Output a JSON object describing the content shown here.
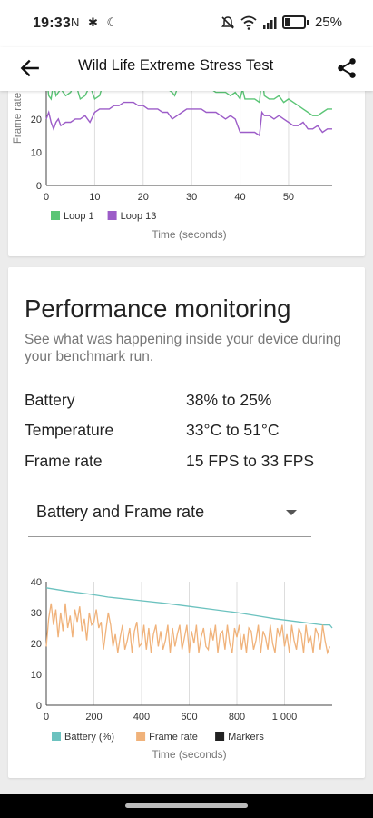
{
  "status_bar": {
    "time": "19:33",
    "left_icons": "N ✱ ☾",
    "battery_text": "25%"
  },
  "app_bar": {
    "title": "Wild Life Extreme Stress Test"
  },
  "chart_data": [
    {
      "type": "line",
      "title": "",
      "xlabel": "Time (seconds)",
      "ylabel": "Frame rate",
      "xlim": [
        0,
        59
      ],
      "ylim": [
        0,
        35
      ],
      "x_ticks": [
        "0",
        "10",
        "20",
        "30",
        "40",
        "50"
      ],
      "y_ticks": [
        "0",
        "10",
        "20"
      ],
      "legend_position": "bottom",
      "series": [
        {
          "name": "Loop 1",
          "color": "#5bc576",
          "x": [
            0,
            0.5,
            1,
            1.5,
            2,
            2.5,
            3,
            4,
            5,
            6,
            7,
            8,
            9,
            10,
            11,
            12,
            12.5,
            13,
            14,
            15,
            16,
            17,
            18,
            19,
            20,
            21,
            22,
            23,
            24,
            25,
            26,
            26.5,
            27,
            28,
            29,
            30,
            31,
            32,
            33,
            34,
            35,
            36,
            37,
            38,
            39,
            40,
            40.5,
            41,
            42,
            43,
            44,
            44.5,
            45,
            46,
            47,
            48,
            49,
            50,
            51,
            52,
            53,
            54,
            55,
            56,
            57,
            58,
            59
          ],
          "y": [
            33,
            27,
            26,
            31,
            27,
            28,
            29,
            27,
            28,
            31,
            26,
            27,
            30,
            26,
            27,
            32,
            29,
            31,
            30,
            31,
            31,
            30,
            31,
            31,
            31,
            30,
            31,
            31,
            30,
            29,
            28,
            27,
            29,
            30,
            30,
            29,
            30,
            29,
            29,
            29,
            28,
            28,
            28,
            27,
            28,
            26,
            29,
            26,
            26,
            26,
            25,
            33,
            27,
            26,
            26,
            27,
            25,
            26,
            25,
            24,
            23,
            22,
            21,
            21,
            22,
            23,
            23
          ]
        },
        {
          "name": "Loop 13",
          "color": "#9c5cc8",
          "x": [
            0,
            0.5,
            1,
            1.5,
            2,
            2.5,
            3,
            4,
            5,
            6,
            7,
            8,
            9,
            10,
            11,
            12,
            13,
            14,
            15,
            16,
            17,
            18,
            19,
            20,
            21,
            22,
            23,
            24,
            25,
            26,
            27,
            28,
            29,
            30,
            31,
            32,
            33,
            34,
            35,
            36,
            37,
            38,
            39,
            40,
            41,
            42,
            43,
            44,
            44.5,
            45,
            46,
            47,
            48,
            49,
            50,
            51,
            52,
            53,
            54,
            55,
            56,
            57,
            58,
            59
          ],
          "y": [
            20,
            22,
            19,
            17,
            19,
            20,
            18,
            19,
            19,
            20,
            20,
            21,
            19,
            22,
            23,
            23,
            23,
            24,
            24,
            25,
            25,
            25,
            24,
            24,
            23,
            23,
            23,
            22,
            22,
            20,
            21,
            22,
            23,
            23,
            23,
            23,
            22,
            22,
            22,
            21,
            20,
            21,
            20,
            16,
            16,
            16,
            16,
            15,
            22,
            21,
            21,
            20,
            21,
            20,
            19,
            18,
            18,
            19,
            17,
            17,
            18,
            16,
            17,
            17
          ]
        }
      ]
    },
    {
      "type": "line",
      "title": "",
      "xlabel": "Time (seconds)",
      "ylabel": "",
      "xlim": [
        0,
        1200
      ],
      "ylim": [
        0,
        40
      ],
      "x_ticks": [
        "0",
        "200",
        "400",
        "600",
        "800",
        "1 000"
      ],
      "y_ticks": [
        "0",
        "10",
        "20",
        "30",
        "40"
      ],
      "legend_position": "bottom",
      "series": [
        {
          "name": "Battery (%)",
          "color": "#6cc2bf",
          "x": [
            0,
            80,
            180,
            260,
            380,
            500,
            600,
            700,
            800,
            880,
            960,
            1060,
            1160,
            1190,
            1200
          ],
          "y": [
            38,
            37,
            36,
            35,
            34,
            33,
            32,
            31,
            30,
            29,
            28,
            27,
            26,
            26,
            25
          ]
        },
        {
          "name": "Frame rate",
          "color": "#f0b27a",
          "x": [
            0,
            10,
            20,
            30,
            40,
            50,
            60,
            70,
            80,
            90,
            100,
            110,
            120,
            130,
            140,
            150,
            160,
            170,
            180,
            190,
            200,
            210,
            220,
            230,
            240,
            250,
            260,
            270,
            280,
            290,
            300,
            310,
            320,
            330,
            340,
            350,
            360,
            370,
            380,
            390,
            400,
            410,
            420,
            430,
            440,
            450,
            460,
            470,
            480,
            490,
            500,
            510,
            520,
            530,
            540,
            550,
            560,
            570,
            580,
            590,
            600,
            610,
            620,
            630,
            640,
            650,
            660,
            670,
            680,
            690,
            700,
            710,
            720,
            730,
            740,
            750,
            760,
            770,
            780,
            790,
            800,
            810,
            820,
            830,
            840,
            850,
            860,
            870,
            880,
            890,
            900,
            910,
            920,
            930,
            940,
            950,
            960,
            970,
            980,
            990,
            1000,
            1010,
            1020,
            1030,
            1040,
            1050,
            1060,
            1070,
            1080,
            1090,
            1100,
            1110,
            1120,
            1130,
            1140,
            1150,
            1160,
            1170,
            1180,
            1190
          ],
          "y": [
            19,
            28,
            33,
            26,
            31,
            22,
            30,
            24,
            33,
            25,
            29,
            22,
            31,
            27,
            32,
            24,
            28,
            21,
            30,
            26,
            27,
            31,
            25,
            27,
            18,
            24,
            30,
            26,
            19,
            23,
            17,
            22,
            26,
            18,
            21,
            25,
            17,
            24,
            27,
            19,
            20,
            26,
            18,
            25,
            17,
            23,
            26,
            19,
            24,
            18,
            21,
            26,
            17,
            25,
            19,
            23,
            26,
            18,
            22,
            26,
            17,
            24,
            20,
            26,
            17,
            22,
            25,
            19,
            18,
            25,
            21,
            26,
            17,
            23,
            24,
            18,
            26,
            20,
            17,
            25,
            22,
            26,
            18,
            23,
            17,
            25,
            24,
            18,
            21,
            26,
            17,
            24,
            22,
            18,
            26,
            20,
            17,
            25,
            22,
            26,
            19,
            23,
            17,
            26,
            21,
            18,
            25,
            23,
            17,
            26,
            20,
            22,
            17,
            25,
            23,
            18,
            26,
            21,
            17,
            19
          ]
        },
        {
          "name": "Markers",
          "color": "#222222",
          "x": [],
          "y": []
        }
      ]
    }
  ],
  "performance": {
    "title": "Performance monitoring",
    "description": "See what was happening inside your device during your benchmark run.",
    "rows": [
      {
        "label": "Battery",
        "value": "38% to 25%"
      },
      {
        "label": "Temperature",
        "value": "33°C to 51°C"
      },
      {
        "label": "Frame rate",
        "value": "15 FPS to 33 FPS"
      }
    ],
    "dropdown": {
      "selected": "Battery and Frame rate"
    }
  }
}
